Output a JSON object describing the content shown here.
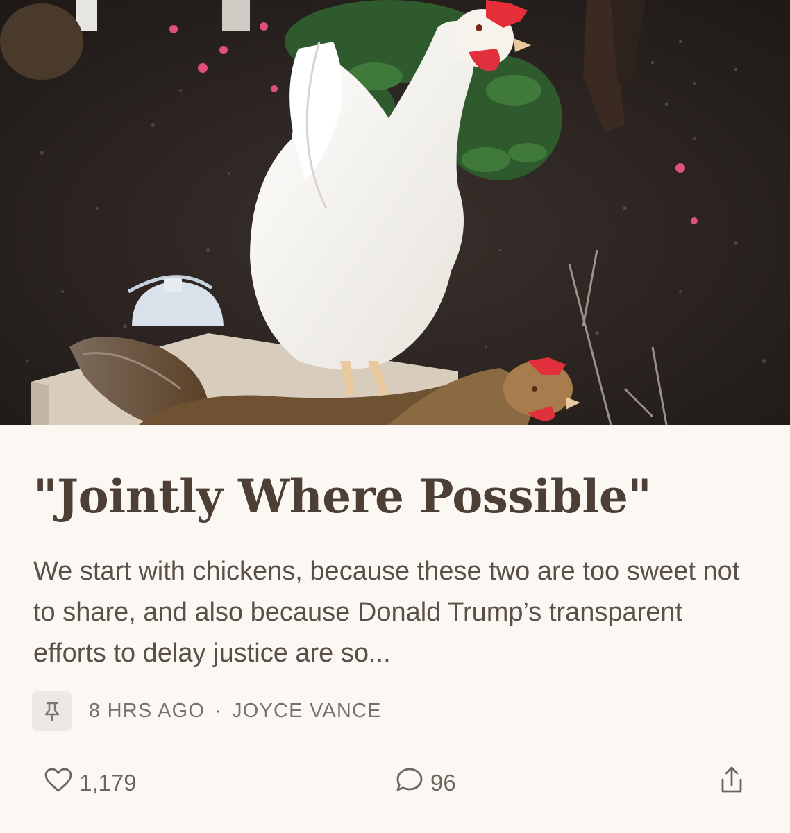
{
  "post": {
    "title": "\"Jointly Where Possible\"",
    "subtitle": "We start with chickens, because these two are too sweet not to share, and also because Donald Trump’s transparent efforts to delay justice are so...",
    "time_ago": "8 HRS AGO",
    "separator": "·",
    "author": "JOYCE VANCE"
  },
  "actions": {
    "likes": "1,179",
    "comments": "96"
  },
  "icons": {
    "pin": "pin-icon",
    "like": "heart-icon",
    "comment": "comment-bubble-icon",
    "share": "share-icon"
  },
  "colors": {
    "background": "#fbf8f4",
    "title": "#4c4036",
    "body_text": "#5b5048",
    "meta_text": "#7a7069",
    "badge": "#ece8e3"
  }
}
